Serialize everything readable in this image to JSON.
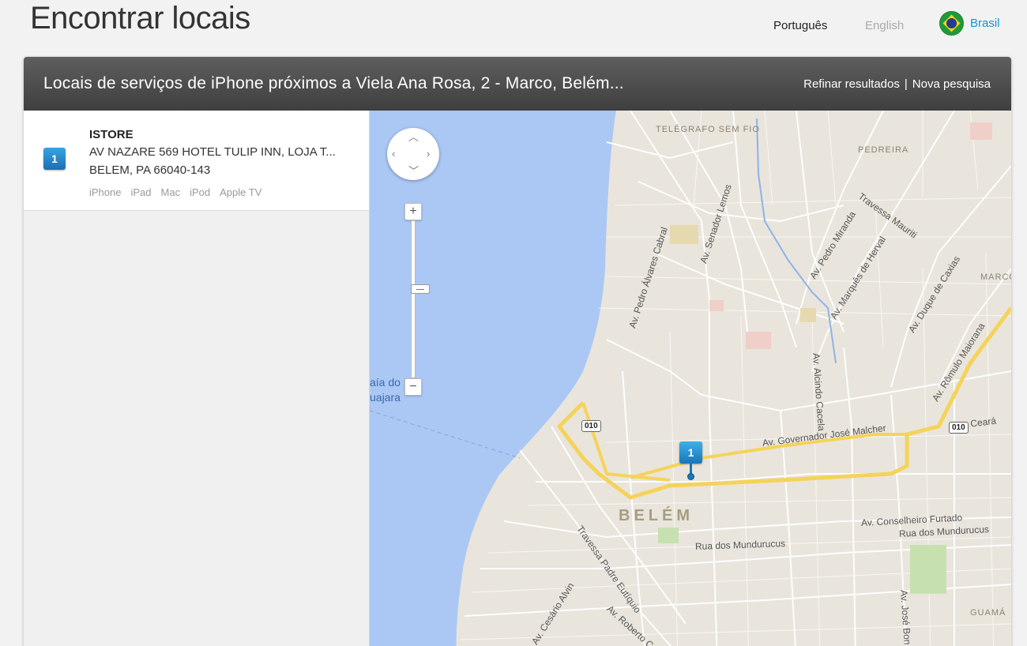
{
  "page": {
    "title": "Encontrar locais"
  },
  "languages": {
    "current": "Português",
    "other": "English"
  },
  "country": {
    "label": "Brasil",
    "flag_icon": "brazil-flag-icon"
  },
  "panel": {
    "title": "Locais de serviços de iPhone próximos a Viela Ana Rosa, 2 - Marco, Belém...",
    "refine_link": "Refinar resultados",
    "separator": "|",
    "new_search_link": "Nova pesquisa"
  },
  "results": [
    {
      "number": "1",
      "name": "ISTORE",
      "address_line1": "AV NAZARE 569 HOTEL TULIP INN, LOJA T...",
      "address_line2": "BELEM, PA 66040-143",
      "products": [
        "iPhone",
        "iPad",
        "Mac",
        "iPod",
        "Apple TV"
      ]
    }
  ],
  "map": {
    "pin_number": "1",
    "zoom_in": "+",
    "zoom_out": "−",
    "labels": {
      "telegrafo": "TELÉGRAFO SEM FIO",
      "pedreira": "PEDREIRA",
      "marco": "MARCO",
      "travessa_mauriti": "Travessa Mauriti",
      "av_pedro_miranda": "Av. Pedro Miranda",
      "av_marques_herval": "Av. Marquês de Herval",
      "av_duque_caxias": "Av. Duque de Caxias",
      "av_romulo_maiorana": "Av. Rômulo Maiorana",
      "av_pedro_alvares_cabral": "Av. Pedro Álvares Cabral",
      "av_senador_lemos": "Av. Senador Lemos",
      "av_alcindo_cacela": "Av. Alcindo Cacela",
      "av_governador": "Av. Governador José Malcher",
      "av_ceara": "Av. Ceará",
      "belem": "BELÉM",
      "av_conselheiro": "Av. Conselheiro Furtado",
      "rua_mundurucus_1": "Rua dos Mundurucus",
      "rua_mundurucus_2": "Rua dos Mundurucus",
      "travessa_padre": "Travessa Padre Eutíquio",
      "av_cesario": "Av. Cesário Alvin",
      "av_roberto": "Av. Roberto C",
      "av_jose_bon": "Av. José Bon",
      "guama": "GUAMÁ",
      "baia_1": "aía do",
      "baia_2": "uajara",
      "shield_010_a": "010",
      "shield_010_b": "010"
    }
  },
  "colors": {
    "header_bg": "#4d4d4d",
    "accent_blue": "#1a8fd1",
    "water": "#abc8f5",
    "land": "#e9e5dc",
    "highway": "#f5d35a"
  }
}
